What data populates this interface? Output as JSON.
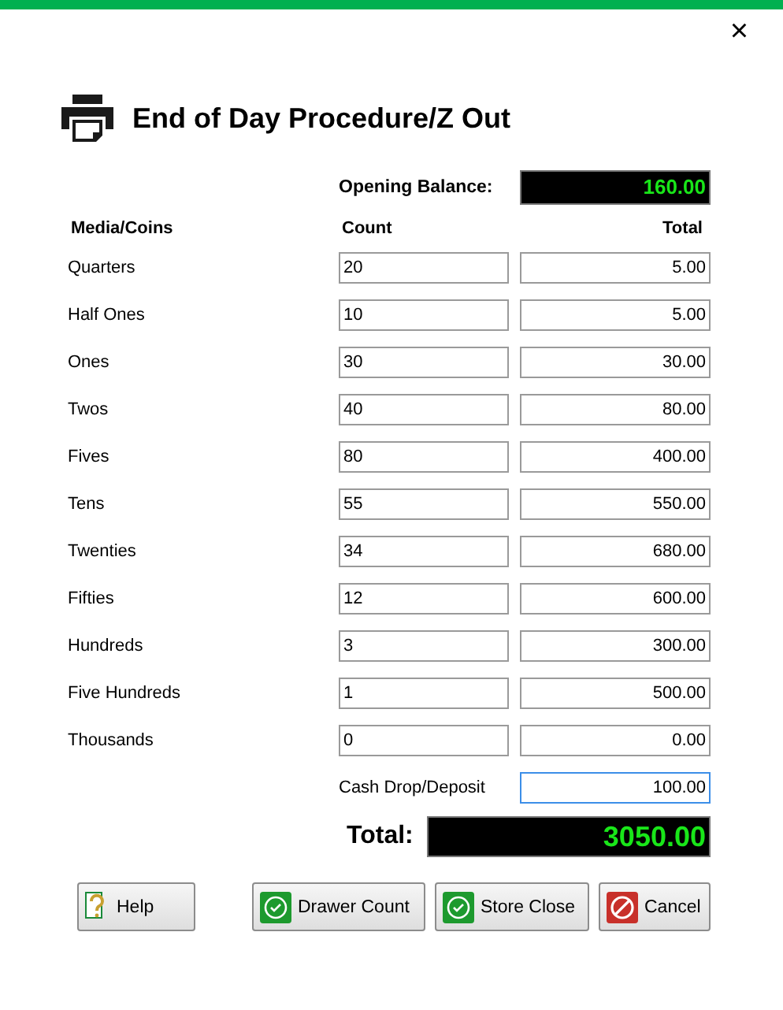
{
  "window": {
    "close": "×"
  },
  "title": "End of Day Procedure/Z Out",
  "opening_balance": {
    "label": "Opening Balance:",
    "value": "160.00"
  },
  "columns": [
    "Media/Coins",
    "Count",
    "Total"
  ],
  "rows": [
    {
      "name": "Quarters",
      "count": "20",
      "total": "5.00"
    },
    {
      "name": "Half Ones",
      "count": "10",
      "total": "5.00"
    },
    {
      "name": "Ones",
      "count": "30",
      "total": "30.00"
    },
    {
      "name": "Twos",
      "count": "40",
      "total": "80.00"
    },
    {
      "name": "Fives",
      "count": "80",
      "total": "400.00"
    },
    {
      "name": "Tens",
      "count": "55",
      "total": "550.00"
    },
    {
      "name": "Twenties",
      "count": "34",
      "total": "680.00"
    },
    {
      "name": "Fifties",
      "count": "12",
      "total": "600.00"
    },
    {
      "name": "Hundreds",
      "count": "3",
      "total": "300.00"
    },
    {
      "name": "Five Hundreds",
      "count": "1",
      "total": "500.00"
    },
    {
      "name": "Thousands",
      "count": "0",
      "total": "0.00"
    }
  ],
  "cash_drop": {
    "label": "Cash Drop/Deposit",
    "value": "100.00",
    "focused": true
  },
  "total": {
    "label": "Total:",
    "value": "3050.00"
  },
  "buttons": [
    {
      "kind": "help",
      "label": "Help"
    },
    {
      "kind": "ok",
      "label": "Drawer Count"
    },
    {
      "kind": "ok",
      "label": "Store Close"
    },
    {
      "kind": "cancel",
      "label": "Cancel"
    }
  ]
}
